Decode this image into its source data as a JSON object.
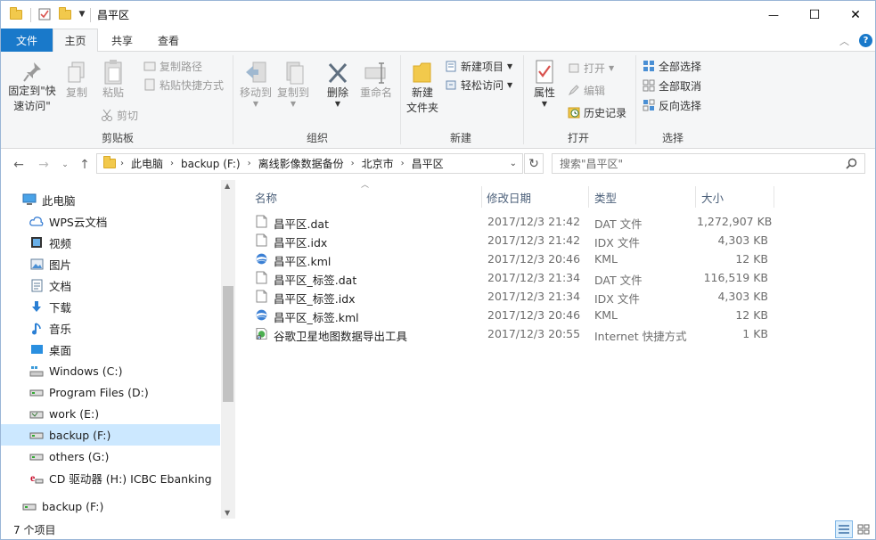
{
  "window": {
    "title": "昌平区",
    "controls": {
      "minimize": "—",
      "maximize": "☐",
      "close": "✕"
    }
  },
  "ribbon_tabs": [
    "文件",
    "主页",
    "共享",
    "查看"
  ],
  "ribbon": {
    "clipboard": {
      "pin": "固定到\"快",
      "pin2": "速访问\"",
      "copy": "复制",
      "paste": "粘贴",
      "copy_path": "复制路径",
      "paste_shortcut": "粘贴快捷方式",
      "cut": "剪切",
      "label": "剪贴板"
    },
    "organize": {
      "move_to": "移动到",
      "copy_to": "复制到",
      "delete": "删除",
      "rename": "重命名",
      "label": "组织"
    },
    "new": {
      "new_folder": "新建",
      "new_folder2": "文件夹",
      "new_item": "新建项目",
      "easy_access": "轻松访问",
      "label": "新建"
    },
    "open": {
      "properties": "属性",
      "open": "打开",
      "edit": "编辑",
      "history": "历史记录",
      "label": "打开"
    },
    "select": {
      "select_all": "全部选择",
      "select_none": "全部取消",
      "invert": "反向选择",
      "label": "选择"
    }
  },
  "address": {
    "breadcrumbs": [
      "此电脑",
      "backup (F:)",
      "离线影像数据备份",
      "北京市",
      "昌平区"
    ],
    "search_placeholder": "搜索\"昌平区\""
  },
  "nav": [
    {
      "label": "此电脑",
      "icon": "computer-icon"
    },
    {
      "label": "WPS云文档",
      "icon": "cloud-icon"
    },
    {
      "label": "视频",
      "icon": "video-icon"
    },
    {
      "label": "图片",
      "icon": "picture-icon"
    },
    {
      "label": "文档",
      "icon": "document-icon"
    },
    {
      "label": "下载",
      "icon": "download-icon"
    },
    {
      "label": "音乐",
      "icon": "music-icon"
    },
    {
      "label": "桌面",
      "icon": "desktop-icon"
    },
    {
      "label": "Windows (C:)",
      "icon": "windows-drive-icon"
    },
    {
      "label": "Program Files (D:)",
      "icon": "drive-icon"
    },
    {
      "label": "work (E:)",
      "icon": "drive-icon"
    },
    {
      "label": "backup (F:)",
      "icon": "drive-icon",
      "selected": true
    },
    {
      "label": "others (G:)",
      "icon": "drive-icon"
    },
    {
      "label": "CD 驱动器 (H:) ICBC Ebanking",
      "icon": "cd-drive-icon"
    },
    {
      "label": "backup (F:)",
      "icon": "drive-icon"
    }
  ],
  "columns": [
    "名称",
    "修改日期",
    "类型",
    "大小"
  ],
  "files": [
    {
      "name": "昌平区.dat",
      "date": "2017/12/3 21:42",
      "type": "DAT 文件",
      "size": "1,272,907 KB",
      "icon": "file-icon"
    },
    {
      "name": "昌平区.idx",
      "date": "2017/12/3 21:42",
      "type": "IDX 文件",
      "size": "4,303 KB",
      "icon": "file-icon"
    },
    {
      "name": "昌平区.kml",
      "date": "2017/12/3 20:46",
      "type": "KML",
      "size": "12 KB",
      "icon": "google-earth-icon"
    },
    {
      "name": "昌平区_标签.dat",
      "date": "2017/12/3 21:34",
      "type": "DAT 文件",
      "size": "116,519 KB",
      "icon": "file-icon"
    },
    {
      "name": "昌平区_标签.idx",
      "date": "2017/12/3 21:34",
      "type": "IDX 文件",
      "size": "4,303 KB",
      "icon": "file-icon"
    },
    {
      "name": "昌平区_标签.kml",
      "date": "2017/12/3 20:46",
      "type": "KML",
      "size": "12 KB",
      "icon": "google-earth-icon"
    },
    {
      "name": "谷歌卫星地图数据导出工具",
      "date": "2017/12/3 20:55",
      "type": "Internet 快捷方式",
      "size": "1 KB",
      "icon": "internet-shortcut-icon"
    }
  ],
  "status": {
    "count": "7 个项目"
  }
}
